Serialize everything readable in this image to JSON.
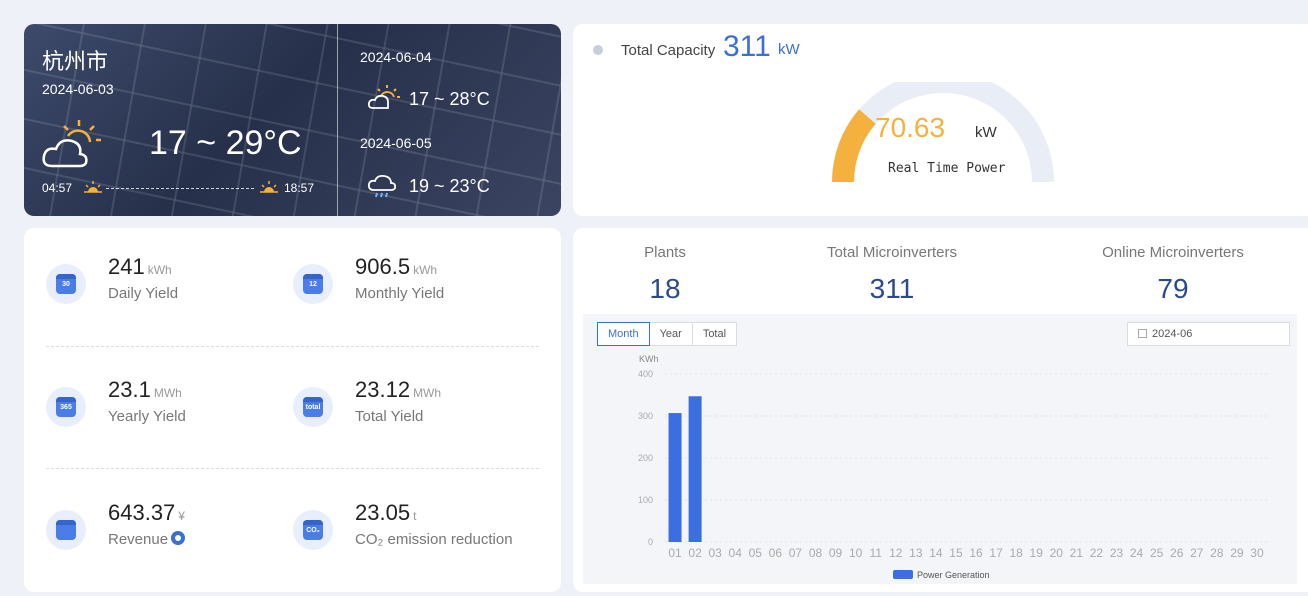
{
  "weather": {
    "city": "杭州市",
    "today": {
      "date": "2024-06-03",
      "temp": "17 ~ 29°C",
      "icon": "partly-cloudy-sun-icon",
      "sunrise": "04:57",
      "sunset": "18:57"
    },
    "forecast": [
      {
        "date": "2024-06-04",
        "temp": "17 ~ 28°C",
        "icon": "sun-cloud-icon"
      },
      {
        "date": "2024-06-05",
        "temp": "19 ~ 23°C",
        "icon": "cloud-rain-icon"
      }
    ]
  },
  "capacity": {
    "label": "Total Capacity",
    "value": "311",
    "unit": "kW",
    "realtime_value": "70.63",
    "realtime_unit": "kW",
    "realtime_label": "Real Time Power",
    "realtime_fraction": 0.227
  },
  "yields": [
    {
      "value": "241",
      "unit": "kWh",
      "label": "Daily Yield",
      "icon": "calendar-30-icon",
      "icon_text": "30"
    },
    {
      "value": "906.5",
      "unit": "kWh",
      "label": "Monthly Yield",
      "icon": "calendar-12-icon",
      "icon_text": "12"
    },
    {
      "value": "23.1",
      "unit": "MWh",
      "label": "Yearly Yield",
      "icon": "calendar-365-icon",
      "icon_text": "365"
    },
    {
      "value": "23.12",
      "unit": "MWh",
      "label": "Total Yield",
      "icon": "calendar-total-icon",
      "icon_text": "total"
    },
    {
      "value": "643.37",
      "unit": "¥",
      "label": "Revenue",
      "icon": "revenue-icon",
      "icon_text": ""
    },
    {
      "value": "23.05",
      "unit": "t",
      "label": "CO₂ emission reduction",
      "icon": "co2-cloud-icon",
      "icon_text": "CO₂"
    }
  ],
  "stats": [
    {
      "label": "Plants",
      "value": "18"
    },
    {
      "label": "Total Microinverters",
      "value": "311"
    },
    {
      "label": "Online Microinverters",
      "value": "79"
    }
  ],
  "chart_controls": {
    "tabs": [
      "Month",
      "Year",
      "Total"
    ],
    "active_tab": "Month",
    "date": "2024-06"
  },
  "colors": {
    "accent": "#3a6fd8",
    "gauge": "#f5b13d",
    "bar": "#3b6fe0"
  },
  "chart_data": {
    "type": "bar",
    "ylabel": "KWh",
    "ylim": [
      0,
      400
    ],
    "yticks": [
      0,
      100,
      200,
      300,
      400
    ],
    "categories": [
      "01",
      "02",
      "03",
      "04",
      "05",
      "06",
      "07",
      "08",
      "09",
      "10",
      "11",
      "12",
      "13",
      "14",
      "15",
      "16",
      "17",
      "18",
      "19",
      "20",
      "21",
      "22",
      "23",
      "24",
      "25",
      "26",
      "27",
      "28",
      "29",
      "30"
    ],
    "series": [
      {
        "name": "Power Generation",
        "values": [
          307,
          347,
          0,
          0,
          0,
          0,
          0,
          0,
          0,
          0,
          0,
          0,
          0,
          0,
          0,
          0,
          0,
          0,
          0,
          0,
          0,
          0,
          0,
          0,
          0,
          0,
          0,
          0,
          0,
          0
        ]
      }
    ],
    "grid": true,
    "legend": "bottom"
  }
}
